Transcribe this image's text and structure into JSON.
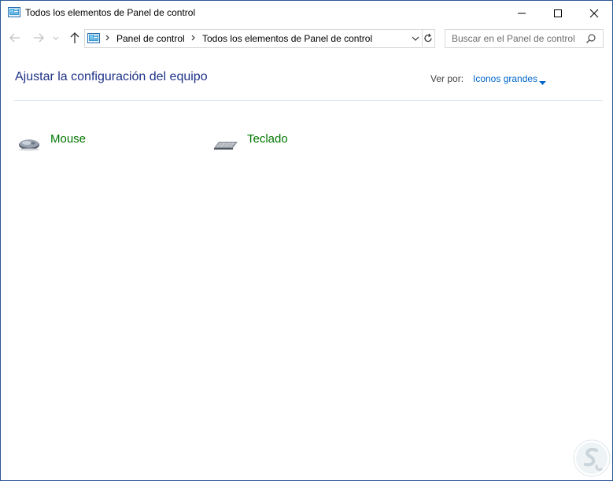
{
  "window": {
    "title": "Todos los elementos de Panel de control"
  },
  "address_bar": {
    "breadcrumbs": [
      "Panel de control",
      "Todos los elementos de Panel de control"
    ]
  },
  "search": {
    "placeholder": "Buscar en el Panel de control"
  },
  "content": {
    "heading": "Ajustar la configuración del equipo",
    "view_by_label": "Ver por:",
    "view_by_value": "Iconos grandes",
    "items": [
      {
        "label": "Mouse",
        "icon": "mouse-icon"
      },
      {
        "label": "Teclado",
        "icon": "keyboard-icon"
      }
    ]
  },
  "colors": {
    "heading": "#1e3287",
    "link_blue": "#0066cc",
    "item_green": "#007600",
    "window_border": "#2b5797"
  }
}
